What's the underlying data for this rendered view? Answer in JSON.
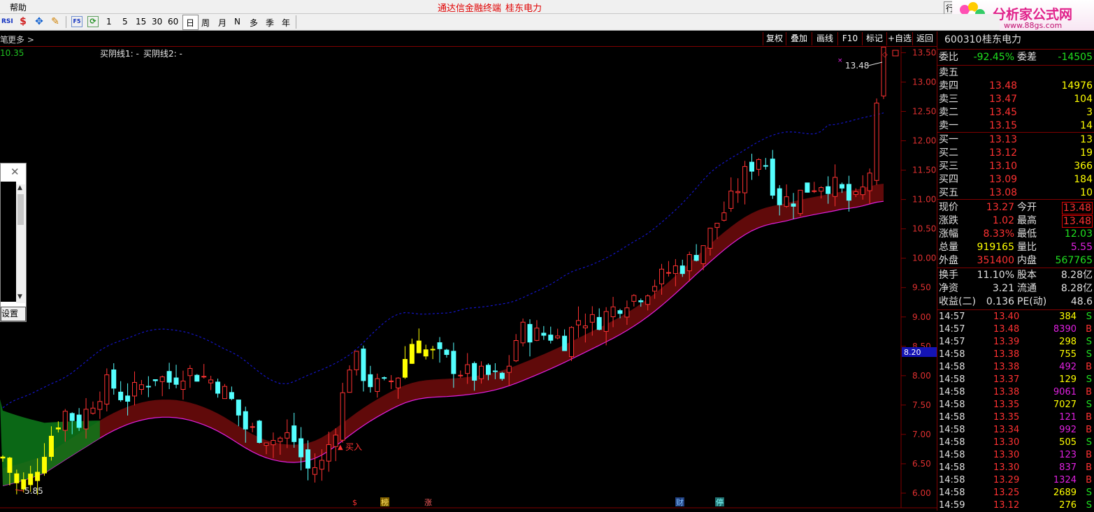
{
  "menu": {
    "help": "帮助",
    "center_text": "通达信金融终端",
    "stock_name_title": "桂东电力",
    "right_partial": "行"
  },
  "logo": {
    "text": "分析家公式网",
    "url_text": "www.88gs.com"
  },
  "toolbar": {
    "icons": [
      "rsi-icon",
      "dollar-icon",
      "move-icon",
      "pencil-icon",
      "f5-icon",
      "refresh-icon"
    ],
    "rsi": "RSI",
    "f5": "F5",
    "periods": [
      "1",
      "5",
      "15",
      "30",
      "60",
      "日",
      "周",
      "月",
      "N",
      "多",
      "季",
      "年"
    ],
    "selected_period": "日"
  },
  "tabbar": {
    "left_partial": "笔",
    "more": "更多 >",
    "buttons": [
      "复权",
      "叠加",
      "画线",
      "F10",
      "标记",
      "+自选",
      "返回"
    ]
  },
  "chart": {
    "top_left_value": "10.35",
    "indicator1": "买阴线1: -",
    "indicator2": "买阴线2: -",
    "high_label": "13.48",
    "low_label": "5.85",
    "buy_label": "买入",
    "price_box": "8.20",
    "bottom_markers": [
      "$",
      "榜",
      "涨",
      "财",
      "停"
    ]
  },
  "chart_data": {
    "type": "candlestick",
    "y_ticks": [
      "13.50",
      "13.00",
      "12.50",
      "12.00",
      "11.50",
      "11.00",
      "10.50",
      "10.00",
      "9.50",
      "9.00",
      "8.50",
      "8.00",
      "7.50",
      "7.00",
      "6.50",
      "6.00"
    ],
    "ylim": [
      5.75,
      13.6
    ],
    "close_estimates": [
      6.6,
      6.1,
      6.3,
      6.9,
      7.4,
      7.2,
      7.6,
      7.9,
      7.6,
      7.8,
      8.0,
      7.9,
      8.1,
      8.0,
      7.9,
      7.6,
      7.1,
      7.0,
      6.9,
      7.0,
      6.4,
      6.5,
      7.2,
      8.4,
      7.9,
      7.8,
      8.0,
      8.6,
      8.4,
      8.3,
      8.1,
      8.0,
      8.0,
      7.9,
      8.8,
      8.7,
      8.7,
      8.6,
      9.0,
      8.9,
      9.1,
      9.3,
      9.4,
      9.6,
      9.8,
      9.9,
      10.2,
      10.6,
      11.0,
      11.5,
      11.8,
      11.0,
      11.0,
      11.2,
      11.3,
      11.2,
      10.9,
      11.3,
      13.48
    ]
  },
  "sidebar": {
    "code": "600310",
    "name": "桂东电力",
    "weibi_label": "委比",
    "weibi": "-92.45%",
    "weicha_label": "委差",
    "weicha": "-14505",
    "asks": [
      {
        "label": "卖五",
        "price": "",
        "vol": ""
      },
      {
        "label": "卖四",
        "price": "13.48",
        "vol": "14976"
      },
      {
        "label": "卖三",
        "price": "13.47",
        "vol": "104"
      },
      {
        "label": "卖二",
        "price": "13.45",
        "vol": "3"
      },
      {
        "label": "卖一",
        "price": "13.15",
        "vol": "14"
      }
    ],
    "bids": [
      {
        "label": "买一",
        "price": "13.13",
        "vol": "13"
      },
      {
        "label": "买二",
        "price": "13.12",
        "vol": "19"
      },
      {
        "label": "买三",
        "price": "13.10",
        "vol": "366"
      },
      {
        "label": "买四",
        "price": "13.09",
        "vol": "184"
      },
      {
        "label": "买五",
        "price": "13.08",
        "vol": "10"
      }
    ],
    "quote": [
      {
        "l1": "现价",
        "v1": "13.27",
        "l2": "今开",
        "v2": "13.48"
      },
      {
        "l1": "涨跌",
        "v1": "1.02",
        "l2": "最高",
        "v2": "13.48"
      },
      {
        "l1": "涨幅",
        "v1": "8.33%",
        "l2": "最低",
        "v2": "12.03"
      },
      {
        "l1": "总量",
        "v1": "919165",
        "l2": "量比",
        "v2": "5.55"
      },
      {
        "l1": "外盘",
        "v1": "351400",
        "l2": "内盘",
        "v2": "567765"
      }
    ],
    "fund": [
      {
        "l1": "换手",
        "v1": "11.10%",
        "l2": "股本",
        "v2": "8.28亿"
      },
      {
        "l1": "净资",
        "v1": "3.21",
        "l2": "流通",
        "v2": "8.28亿"
      },
      {
        "l1": "收益(二)",
        "v1": "0.136",
        "l2": "PE(动)",
        "v2": "48.6"
      }
    ],
    "trades": [
      {
        "time": "14:57",
        "price": "13.40",
        "vol": "384",
        "bs": "S"
      },
      {
        "time": "14:57",
        "price": "13.48",
        "vol": "8390",
        "bs": "B"
      },
      {
        "time": "14:57",
        "price": "13.39",
        "vol": "298",
        "bs": "S"
      },
      {
        "time": "14:58",
        "price": "13.38",
        "vol": "755",
        "bs": "S"
      },
      {
        "time": "14:58",
        "price": "13.38",
        "vol": "492",
        "bs": "B"
      },
      {
        "time": "14:58",
        "price": "13.37",
        "vol": "129",
        "bs": "S"
      },
      {
        "time": "14:58",
        "price": "13.38",
        "vol": "9061",
        "bs": "B"
      },
      {
        "time": "14:58",
        "price": "13.35",
        "vol": "7027",
        "bs": "S"
      },
      {
        "time": "14:58",
        "price": "13.35",
        "vol": "121",
        "bs": "B"
      },
      {
        "time": "14:58",
        "price": "13.34",
        "vol": "992",
        "bs": "B"
      },
      {
        "time": "14:58",
        "price": "13.30",
        "vol": "505",
        "bs": "S"
      },
      {
        "time": "14:58",
        "price": "13.30",
        "vol": "123",
        "bs": "B"
      },
      {
        "time": "14:58",
        "price": "13.30",
        "vol": "837",
        "bs": "B"
      },
      {
        "time": "14:58",
        "price": "13.29",
        "vol": "1324",
        "bs": "B"
      },
      {
        "time": "14:58",
        "price": "13.25",
        "vol": "2689",
        "bs": "S"
      },
      {
        "time": "14:59",
        "price": "13.12",
        "vol": "276",
        "bs": "S"
      }
    ]
  },
  "popup": {
    "button": "设置"
  },
  "colors": {
    "up": "#ff3232",
    "down": "#54ffff",
    "signal": "#ffff00",
    "band": "#6a0b0b",
    "green_band": "#0d7a1a",
    "dash_line": "#1414c8",
    "lower_line": "#e020e0"
  }
}
